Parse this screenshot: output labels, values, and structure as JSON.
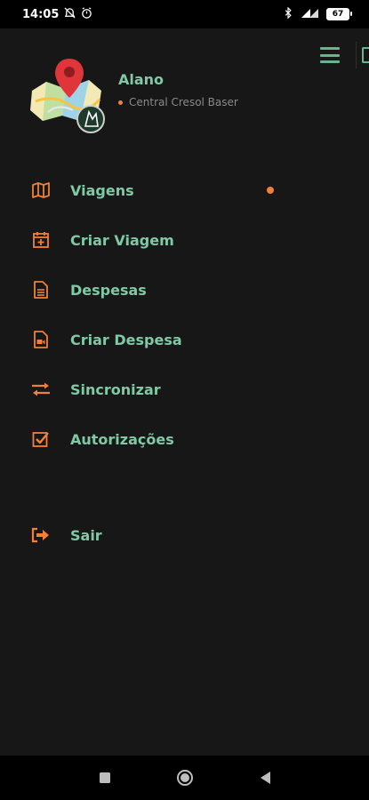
{
  "status_bar": {
    "time": "14:05",
    "battery": "67",
    "icons": [
      "alarm-off-icon",
      "alarm-icon",
      "bluetooth-icon",
      "signal-icon",
      "battery-icon"
    ]
  },
  "header": {
    "menu_icon": "hamburger-icon"
  },
  "profile": {
    "name": "Alano",
    "org": "Central Cresol Baser"
  },
  "menu": {
    "items": [
      {
        "label": "Viagens",
        "icon": "map-icon"
      },
      {
        "label": "Criar Viagem",
        "icon": "calendar-plus-icon"
      },
      {
        "label": "Despesas",
        "icon": "document-icon"
      },
      {
        "label": "Criar Despesa",
        "icon": "document-video-icon"
      },
      {
        "label": "Sincronizar",
        "icon": "sync-arrows-icon"
      },
      {
        "label": "Autorizações",
        "icon": "check-square-icon"
      },
      {
        "label": "Sair",
        "icon": "logout-icon"
      }
    ]
  },
  "colors": {
    "accent": "#7fc9a4",
    "icon_orange": "#f0803a",
    "background": "#171717"
  }
}
